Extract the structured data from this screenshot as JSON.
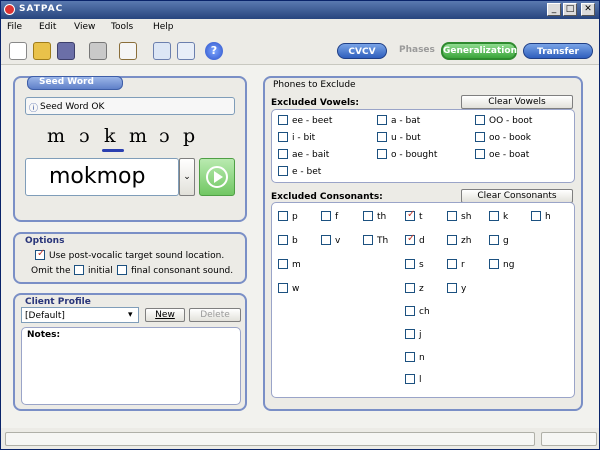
{
  "app": {
    "title": "SATPAC"
  },
  "menu": [
    "File",
    "Edit",
    "View",
    "Tools",
    "Help"
  ],
  "modes": {
    "cvcv": "CVCV",
    "phases": "Phases",
    "generalization": "Generalization",
    "transfer": "Transfer"
  },
  "seed": {
    "legend": "Seed Word",
    "status": "Seed Word OK",
    "phonetic": [
      "m",
      "ɔ",
      "k",
      "m",
      "ɔ",
      "p"
    ],
    "input_value": "mokmop"
  },
  "options": {
    "legend": "Options",
    "post_vocalic_label": "Use post-vocalic target sound location.",
    "omit_prefix": "Omit the",
    "initial_label": "initial",
    "final_label": "final consonant sound."
  },
  "client": {
    "legend": "Client Profile",
    "selected": "[Default]",
    "new_label": "New",
    "delete_label": "Delete",
    "notes_label": "Notes:"
  },
  "phones": {
    "legend": "Phones to Exclude",
    "vowels_title": "Excluded Vowels:",
    "clear_vowels": "Clear Vowels",
    "vowels": [
      {
        "label": "ee - beet",
        "checked": false
      },
      {
        "label": "a - bat",
        "checked": false
      },
      {
        "label": "OO - boot",
        "checked": false
      },
      {
        "label": "i - bit",
        "checked": false
      },
      {
        "label": "u - but",
        "checked": false
      },
      {
        "label": "oo - book",
        "checked": false
      },
      {
        "label": "ae - bait",
        "checked": false
      },
      {
        "label": "o - bought",
        "checked": false
      },
      {
        "label": "oe - boat",
        "checked": false
      },
      {
        "label": "e - bet",
        "checked": false
      }
    ],
    "consonants_title": "Excluded Consonants:",
    "clear_consonants": "Clear Consonants",
    "consonants": [
      {
        "label": "p",
        "checked": false
      },
      {
        "label": "f",
        "checked": false
      },
      {
        "label": "th",
        "checked": false
      },
      {
        "label": "t",
        "checked": true
      },
      {
        "label": "sh",
        "checked": false
      },
      {
        "label": "k",
        "checked": false
      },
      {
        "label": "h",
        "checked": false
      },
      {
        "label": "b",
        "checked": false
      },
      {
        "label": "v",
        "checked": false
      },
      {
        "label": "Th",
        "checked": false
      },
      {
        "label": "d",
        "checked": true
      },
      {
        "label": "zh",
        "checked": false
      },
      {
        "label": "g",
        "checked": false
      },
      {
        "label": "m",
        "checked": false
      },
      {
        "label": "s",
        "checked": false
      },
      {
        "label": "r",
        "checked": false
      },
      {
        "label": "ng",
        "checked": false
      },
      {
        "label": "w",
        "checked": false
      },
      {
        "label": "z",
        "checked": false
      },
      {
        "label": "y",
        "checked": false
      },
      {
        "label": "ch",
        "checked": false
      },
      {
        "label": "j",
        "checked": false
      },
      {
        "label": "n",
        "checked": false
      },
      {
        "label": "l",
        "checked": false
      }
    ]
  },
  "colors": {
    "accent": "#2f5fbd",
    "green": "#3ba53b",
    "panel_border": "#7a8fc6",
    "check": "#c0392b"
  }
}
